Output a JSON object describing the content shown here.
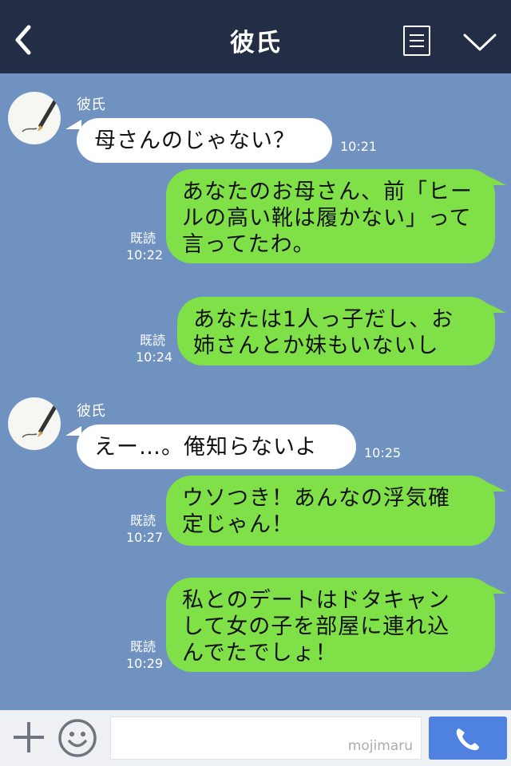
{
  "header": {
    "title": "彼氏"
  },
  "messages": [
    {
      "side": "in",
      "sender": "彼氏",
      "lines": [
        "母さんのじゃない？"
      ],
      "time": "10:21"
    },
    {
      "side": "out",
      "lines": [
        "あなたのお母さん、前「ヒー",
        "ルの高い靴は履かない」って",
        "言ってたわ。"
      ],
      "read": "既読",
      "time": "10:22"
    },
    {
      "side": "out",
      "lines": [
        "あなたは1人っ子だし、お",
        "姉さんとか妹もいないし"
      ],
      "read": "既読",
      "time": "10:24"
    },
    {
      "side": "in",
      "sender": "彼氏",
      "lines": [
        "えー…。俺知らないよ"
      ],
      "time": "10:25"
    },
    {
      "side": "out",
      "lines": [
        "ウソつき！あんなの浮気確",
        "定じゃん！"
      ],
      "read": "既読",
      "time": "10:27"
    },
    {
      "side": "out",
      "lines": [
        "私とのデートはドタキャン",
        "して女の子を部屋に連れ込",
        "んでたでしょ！"
      ],
      "read": "既読",
      "time": "10:29"
    }
  ],
  "inputbar": {
    "placeholder": "",
    "watermark": "mojimaru"
  },
  "icons": {
    "back": "chevron-left-icon",
    "menu": "menu-icon",
    "collapse": "chevron-down-icon",
    "plus": "plus-icon",
    "emoji": "smiley-icon",
    "call": "phone-icon"
  },
  "colors": {
    "header": "#232d45",
    "background": "#7092c1",
    "outgoing": "#80e048",
    "incoming": "#ffffff",
    "call": "#4f82e0"
  }
}
